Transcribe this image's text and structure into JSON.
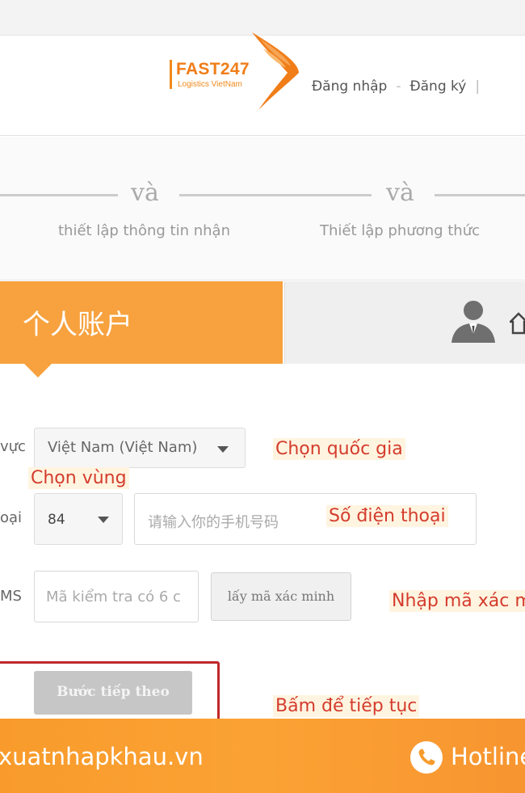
{
  "header": {
    "logo": {
      "name": "FAST247",
      "tagline": "Logistics VietNam"
    },
    "login": "Đăng nhập",
    "separator": "-",
    "register": "Đăng ký",
    "divider": "|"
  },
  "steps": [
    {
      "connector": "và",
      "label": "thiết lập thông tin nhận"
    },
    {
      "connector": "và",
      "label": "Thiết lập phương thức"
    }
  ],
  "tabs": {
    "active_label": "个人账户",
    "inactive_icon": "user-icon"
  },
  "form": {
    "country_label": "vực",
    "country_value": "Việt Nam (Việt Nam)",
    "phone_label": "oại",
    "area_code": "84",
    "phone_placeholder": "请输入你的手机号码",
    "sms_label": "MS",
    "sms_placeholder": "Mã kiểm tra có 6 c",
    "get_code_button": "lấy mã xác minh",
    "next_button": "Bước tiếp theo"
  },
  "annotations": {
    "choose_country": "Chọn quốc gia",
    "choose_region": "Chọn vùng",
    "phone_number": "Số điện thoại",
    "enter_code": "Nhập mã xác m",
    "click_continue": "Bấm để tiếp tục"
  },
  "footer": {
    "website": "xuatnhapkhau.vn",
    "hotline": "Hotline"
  },
  "colors": {
    "accent_orange": "#f7a23e",
    "annotation_red": "#d43c2d",
    "highlight_border": "#c0282c",
    "footer_orange": "#f89b2c"
  }
}
